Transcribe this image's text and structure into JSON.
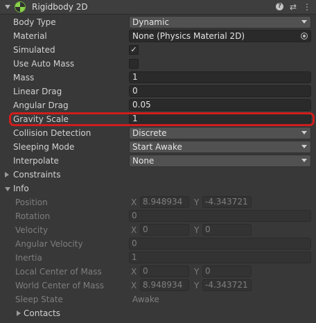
{
  "component": {
    "title": "Rigidbody 2D",
    "help_glyph": "?",
    "presets_glyph": "⇄",
    "menu_glyph": "⋮",
    "icons": [
      "rigidbody2d-icon",
      "help-icon",
      "presets-icon",
      "kebab-menu-icon"
    ]
  },
  "properties": {
    "body_type": {
      "label": "Body Type",
      "value": "Dynamic"
    },
    "material": {
      "label": "Material",
      "value": "None (Physics Material 2D)"
    },
    "simulated": {
      "label": "Simulated",
      "checked": true,
      "glyph": "✓"
    },
    "use_auto_mass": {
      "label": "Use Auto Mass",
      "checked": false
    },
    "mass": {
      "label": "Mass",
      "value": "1"
    },
    "linear_drag": {
      "label": "Linear Drag",
      "value": "0"
    },
    "angular_drag": {
      "label": "Angular Drag",
      "value": "0.05"
    },
    "gravity_scale": {
      "label": "Gravity Scale",
      "value": "1"
    },
    "collision_detection": {
      "label": "Collision Detection",
      "value": "Discrete"
    },
    "sleeping_mode": {
      "label": "Sleeping Mode",
      "value": "Start Awake"
    },
    "interpolate": {
      "label": "Interpolate",
      "value": "None"
    }
  },
  "constraints": {
    "label": "Constraints",
    "expanded": false
  },
  "info": {
    "label": "Info",
    "expanded": true,
    "position": {
      "label": "Position",
      "x_label": "X",
      "x": "8.948934",
      "y_label": "Y",
      "y": "-4.343721"
    },
    "rotation": {
      "label": "Rotation",
      "value": "0"
    },
    "velocity": {
      "label": "Velocity",
      "x_label": "X",
      "x": "0",
      "y_label": "Y",
      "y": "0"
    },
    "angular_velocity": {
      "label": "Angular Velocity",
      "value": "0"
    },
    "inertia": {
      "label": "Inertia",
      "value": "1"
    },
    "local_center_of_mass": {
      "label": "Local Center of Mass",
      "x_label": "X",
      "x": "0",
      "y_label": "Y",
      "y": "0"
    },
    "world_center_of_mass": {
      "label": "World Center of Mass",
      "x_label": "X",
      "x": "8.948934",
      "y_label": "Y",
      "y": "-4.343721"
    },
    "sleep_state": {
      "label": "Sleep State",
      "value": "Awake"
    },
    "contacts": {
      "label": "Contacts",
      "expanded": false
    }
  },
  "colors": {
    "highlight": "#d01e1e",
    "background": "#383838"
  }
}
